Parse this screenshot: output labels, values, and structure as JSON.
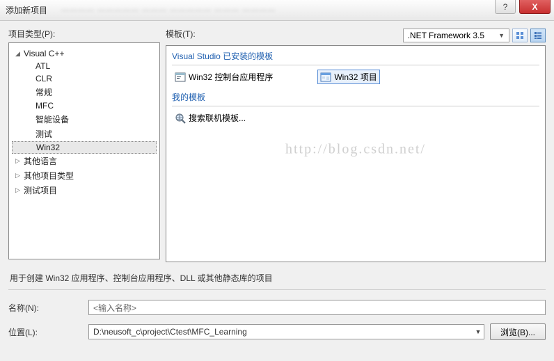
{
  "titlebar": {
    "title": "添加新项目",
    "help": "?",
    "close": "X"
  },
  "labels": {
    "project_types": "项目类型(P):",
    "templates": "模板(T):",
    "name": "名称(N):",
    "location": "位置(L):"
  },
  "framework_dd": {
    "value": ".NET Framework 3.5"
  },
  "tree": {
    "root": "Visual C++",
    "children": [
      "ATL",
      "CLR",
      "常规",
      "MFC",
      "智能设备",
      "测试",
      "Win32"
    ],
    "other": [
      "其他语言",
      "其他项目类型",
      "测试项目"
    ]
  },
  "templates": {
    "installed_label": "Visual Studio 已安装的模板",
    "my_label": "我的模板",
    "items": {
      "win32_console": "Win32 控制台应用程序",
      "win32_project": "Win32 项目",
      "search_online": "搜索联机模板..."
    }
  },
  "description": "用于创建 Win32 应用程序、控制台应用程序、DLL 或其他静态库的项目",
  "form": {
    "name_placeholder": "<输入名称>",
    "location_value": "D:\\neusoft_c\\project\\Ctest\\MFC_Learning",
    "browse_label": "浏览(B)..."
  },
  "watermark": "http://blog.csdn.net/"
}
